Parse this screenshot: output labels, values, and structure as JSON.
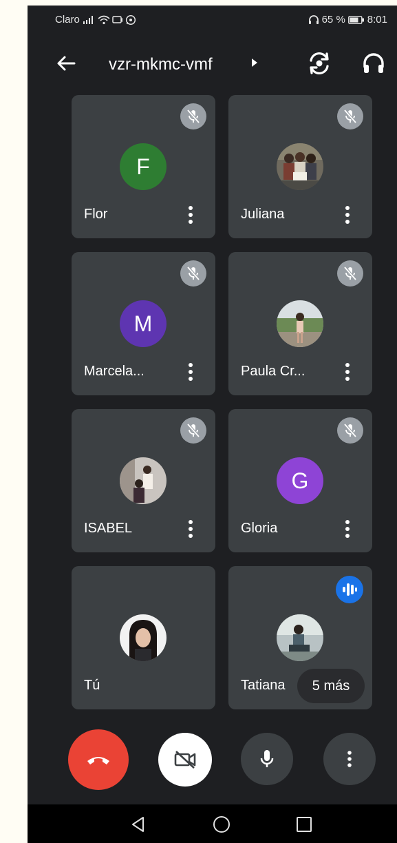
{
  "status_bar": {
    "carrier": "Claro",
    "battery_percent": "65 %",
    "time": "8:01",
    "icons": [
      "signal-icon",
      "wifi-icon",
      "cast-icon",
      "whatsapp-icon",
      "headset-icon",
      "battery-icon"
    ]
  },
  "header": {
    "meeting_code": "vzr-mkmc-vmf",
    "icons": [
      "back-arrow-icon",
      "caret-right-icon",
      "switch-camera-icon",
      "headphones-icon"
    ]
  },
  "participants": [
    {
      "name": "Flor",
      "avatar_type": "initial",
      "initial": "F",
      "avatar_color": "#2e7d32",
      "muted": true
    },
    {
      "name": "Juliana",
      "avatar_type": "photo",
      "muted": true
    },
    {
      "name": "Marcela...",
      "avatar_type": "initial",
      "initial": "M",
      "avatar_color": "#5e35b1",
      "muted": true
    },
    {
      "name": "Paula Cr...",
      "avatar_type": "photo",
      "muted": true
    },
    {
      "name": "ISABEL",
      "avatar_type": "photo",
      "muted": true
    },
    {
      "name": "Gloria",
      "avatar_type": "initial",
      "initial": "G",
      "avatar_color": "#8e44d6",
      "muted": true
    },
    {
      "name": "Tú",
      "avatar_type": "photo",
      "muted": false
    },
    {
      "name": "Tatiana",
      "avatar_type": "photo",
      "muted": false,
      "speaking": true
    }
  ],
  "more_participants_label": "5 más",
  "controls": {
    "icons": [
      "end-call-icon",
      "camera-off-icon",
      "microphone-icon",
      "more-options-icon"
    ],
    "end_call_color": "#ea4335"
  },
  "nav_bar": {
    "icons": [
      "nav-back-icon",
      "nav-home-icon",
      "nav-recent-apps-icon"
    ]
  }
}
